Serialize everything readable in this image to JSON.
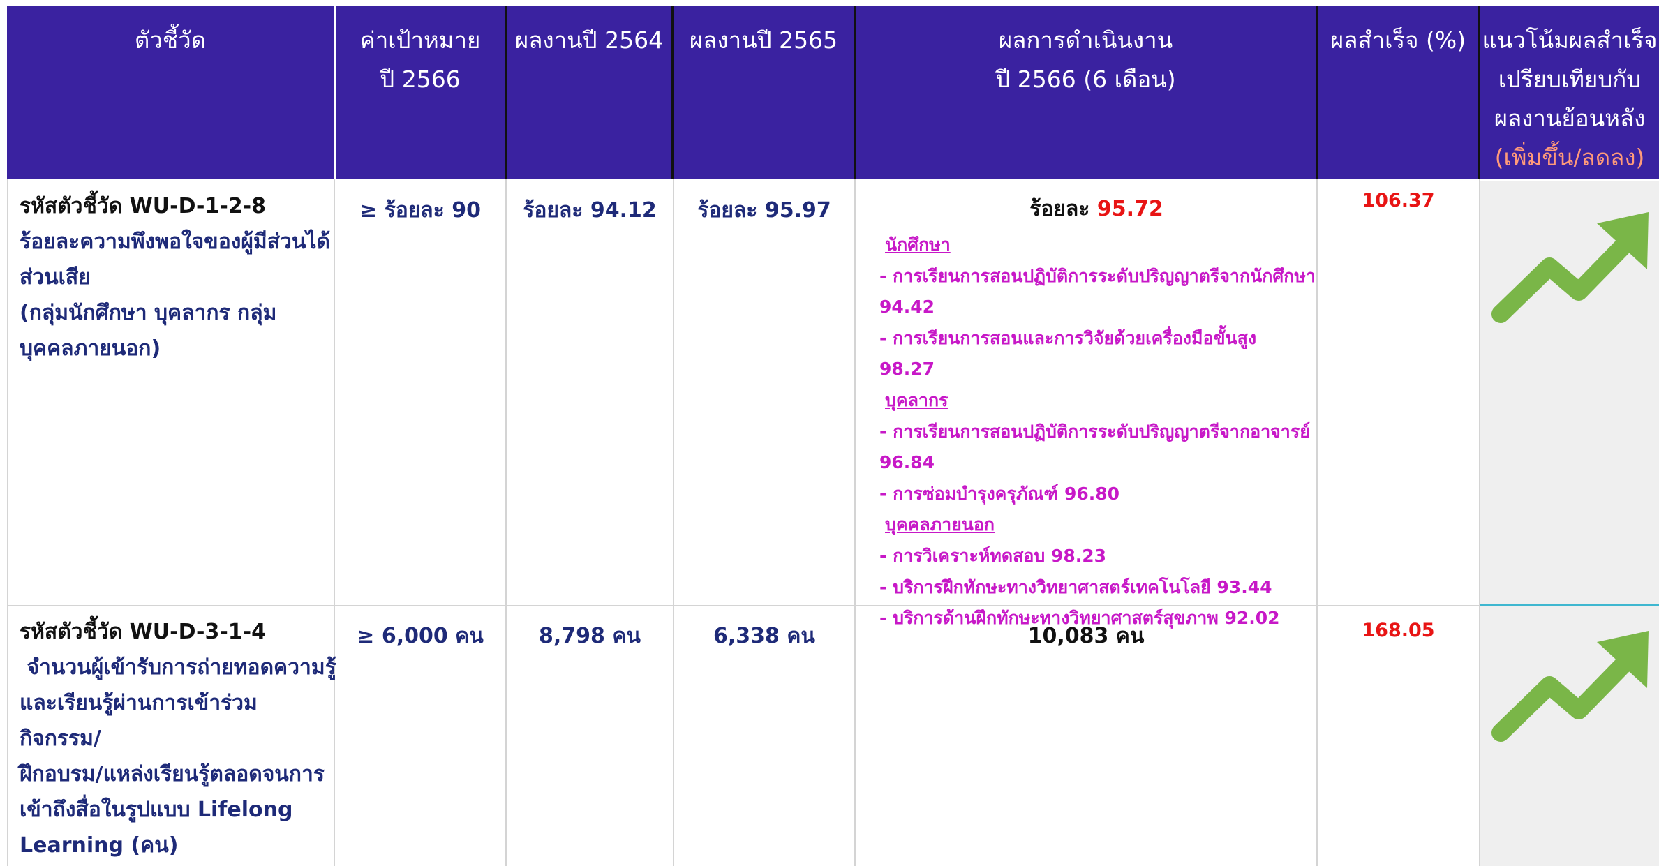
{
  "header": {
    "col_indicator": "ตัวชี้วัด",
    "col_target_l1": "ค่าเป้าหมาย",
    "col_target_l2": "ปี 2566",
    "col_2564": "ผลงานปี 2564",
    "col_2565": "ผลงานปี 2565",
    "col_result_l1": "ผลการดำเนินงาน",
    "col_result_l2": "ปี 2566 (6 เดือน)",
    "col_success": "ผลสำเร็จ (%)",
    "col_trend_l1": "แนวโน้มผลสำเร็จ",
    "col_trend_l2": "เปรียบเทียบกับ",
    "col_trend_l3": "ผลงานย้อนหลัง",
    "col_trend_l4": "(เพิ่มขึ้น/ลดลง)"
  },
  "rows": [
    {
      "code": "รหัสตัวชี้วัด WU-D-1-2-8",
      "name_lines": [
        "ร้อยละความพึงพอใจของผู้มีส่วนได้",
        "ส่วนเสีย",
        "(กลุ่มนักศึกษา บุคลากร กลุ่ม",
        "บุคคลภายนอก)"
      ],
      "target": "≥ ร้อยละ 90",
      "y2564": "ร้อยละ 94.12",
      "y2565": "ร้อยละ 95.97",
      "result_prefix": "ร้อยละ ",
      "result_value": "95.72",
      "result_details": [
        {
          "text": "นักศึกษา",
          "group": true
        },
        {
          "text": " - การเรียนการสอนปฏิบัติการระดับปริญญาตรีจากนักศึกษา",
          "group": false
        },
        {
          "text": "94.42",
          "group": false
        },
        {
          "text": " - การเรียนการสอนและการวิจัยด้วยเครื่องมือขั้นสูง 98.27",
          "group": false
        },
        {
          "text": "บุคลากร",
          "group": true
        },
        {
          "text": " - การเรียนการสอนปฏิบัติการระดับปริญญาตรีจากอาจารย์",
          "group": false
        },
        {
          "text": "96.84",
          "group": false
        },
        {
          "text": " - การซ่อมบำรุงครุภัณฑ์ 96.80",
          "group": false
        },
        {
          "text": "บุคคลภายนอก",
          "group": true
        },
        {
          "text": " - การวิเคราะห์ทดสอบ 98.23",
          "group": false
        },
        {
          "text": " - บริการฝึกทักษะทางวิทยาศาสตร์เทคโนโลยี 93.44",
          "group": false
        },
        {
          "text": " - บริการด้านฝึกทักษะทางวิทยาศาสตร์สุขภาพ 92.02",
          "group": false
        }
      ],
      "success_pct": "106.37",
      "trend_icon": "trend-up-arrow-icon",
      "trend_color": "#7ab648"
    },
    {
      "code": "รหัสตัวชี้วัด WU-D-3-1-4",
      "name_lines": [
        " จำนวนผู้เข้ารับการถ่ายทอดความรู้",
        "และเรียนรู้ผ่านการเข้าร่วมกิจกรรม/",
        "ฝึกอบรม/แหล่งเรียนรู้ตลอดจนการ",
        "เข้าถึงสื่อในรูปแบบ Lifelong",
        "Learning (คน)"
      ],
      "target": "≥ 6,000 คน",
      "y2564": "8,798 คน",
      "y2565": "6,338 คน",
      "result_prefix": "10,083 คน",
      "result_value": "",
      "result_details": [],
      "success_pct": "168.05",
      "trend_icon": "trend-up-arrow-icon",
      "trend_color": "#7ab648"
    }
  ],
  "colors": {
    "header_bg": "#3a22a0",
    "header_text": "#ffffff",
    "trend_note": "#ff9a7a",
    "indicator_text": "#1e2a78",
    "highlight_red": "#e81414",
    "detail_magenta": "#c718c7",
    "trend_cell_bg": "#efefef"
  }
}
